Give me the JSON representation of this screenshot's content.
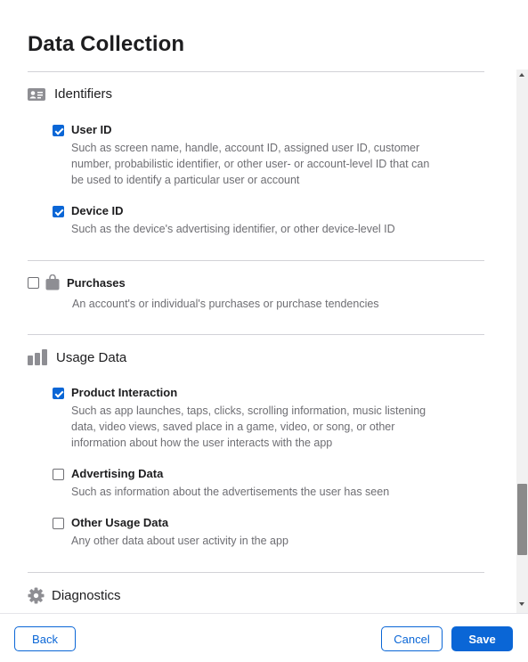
{
  "page": {
    "title": "Data Collection"
  },
  "sections": {
    "identifiers": {
      "label": "Identifiers",
      "icon": "contact-card-icon"
    },
    "purchases": {
      "label": "Purchases",
      "icon": "shopping-bag-icon",
      "checked": false,
      "description": "An account's or individual's purchases or purchase tendencies"
    },
    "usage": {
      "label": "Usage Data",
      "icon": "bar-chart-icon"
    },
    "diagnostics": {
      "label": "Diagnostics",
      "icon": "gear-icon"
    }
  },
  "items": {
    "user_id": {
      "label": "User ID",
      "checked": true,
      "desc_lines": [
        "Such as screen name, handle, account ID, assigned user ID, customer",
        "number, probabilistic identifier, or other user- or account-level ID that can",
        "be used to identify a particular user or account"
      ]
    },
    "device_id": {
      "label": "Device ID",
      "checked": true,
      "desc_lines": [
        "Such as the device's advertising identifier, or other device-level ID"
      ]
    },
    "product_interaction": {
      "label": "Product Interaction",
      "checked": true,
      "desc_lines": [
        "Such as app launches, taps, clicks, scrolling information, music listening",
        "data, video views, saved place in a game, video, or song, or other",
        "information about how the user interacts with the app"
      ]
    },
    "advertising_data": {
      "label": "Advertising Data",
      "checked": false,
      "desc_lines": [
        "Such as information about the advertisements the user has seen"
      ]
    },
    "other_usage_data": {
      "label": "Other Usage Data",
      "checked": false,
      "desc_lines": [
        "Any other data about user activity in the app"
      ]
    }
  },
  "footer": {
    "back_label": "Back",
    "cancel_label": "Cancel",
    "save_label": "Save"
  },
  "colors": {
    "accent": "#0a66d6",
    "text": "#1d1d1f",
    "muted": "#6e6e73",
    "icon": "#8e8e93"
  }
}
